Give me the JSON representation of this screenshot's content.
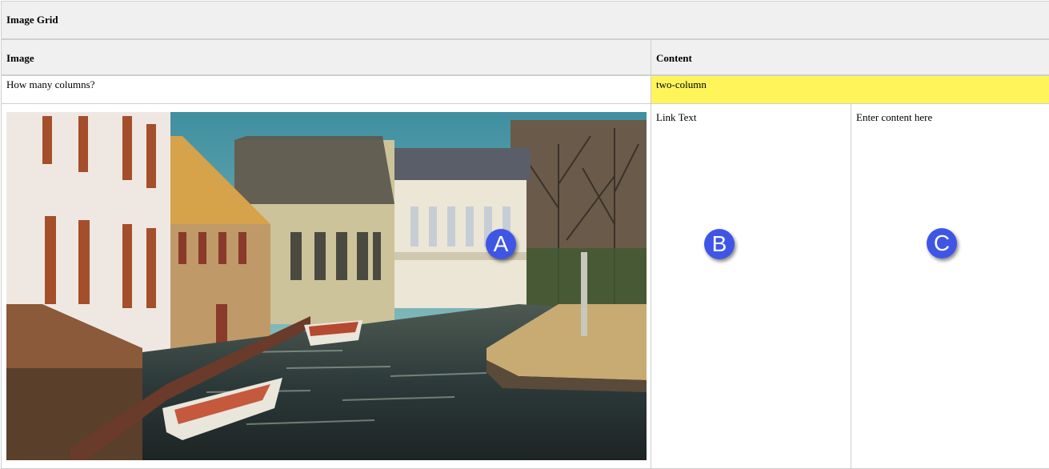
{
  "grid": {
    "title": "Image Grid",
    "headers": {
      "image": "Image",
      "content": "Content"
    },
    "columns_prompt": "How many columns?",
    "columns_value": "two-column",
    "column_b_text": "Link Text",
    "column_c_text": "Enter content here"
  },
  "markers": {
    "a": "A",
    "b": "B",
    "c": "C"
  },
  "colors": {
    "highlight": "#fff55a",
    "marker": "#3f56e5",
    "header_bg": "#f0f0f0",
    "border": "#cfcfcf"
  }
}
